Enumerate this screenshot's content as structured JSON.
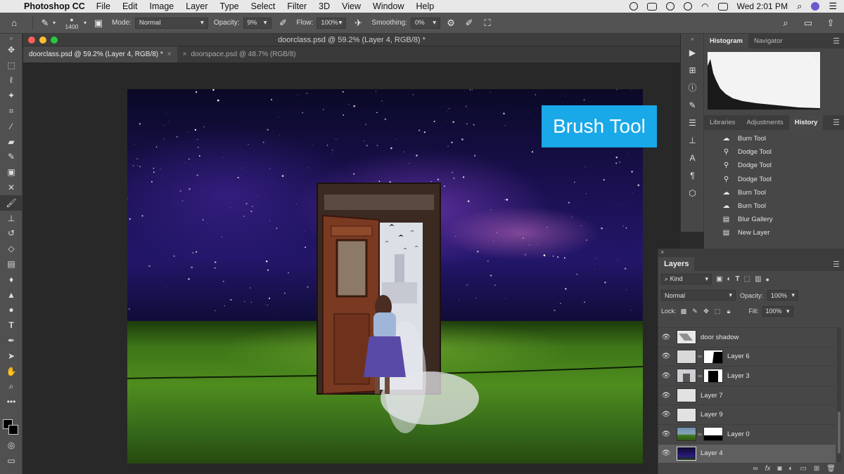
{
  "menubar": {
    "app_name": "Photoshop CC",
    "items": [
      "File",
      "Edit",
      "Image",
      "Layer",
      "Type",
      "Select",
      "Filter",
      "3D",
      "View",
      "Window",
      "Help"
    ],
    "clock": "Wed 2:01 PM"
  },
  "options_bar": {
    "brush_size": "1400",
    "mode_label": "Mode:",
    "mode_value": "Normal",
    "opacity_label": "Opacity:",
    "opacity_value": "9%",
    "flow_label": "Flow:",
    "flow_value": "100%",
    "smoothing_label": "Smoothing:",
    "smoothing_value": "0%"
  },
  "document": {
    "window_title": "doorclass.psd @ 59.2% (Layer 4, RGB/8) *",
    "tabs": [
      {
        "label": "doorclass.psd @ 59.2% (Layer 4, RGB/8) *",
        "active": true
      },
      {
        "label": "doorspace.psd @ 48.7% (RGB/8)",
        "active": false
      }
    ],
    "overlay_label": "Brush Tool"
  },
  "panels": {
    "top_tabs": [
      "Histogram",
      "Navigator"
    ],
    "mid_tabs": [
      "Libraries",
      "Adjustments",
      "History"
    ],
    "history": [
      {
        "label": "Burn Tool",
        "icon": "burn-icon"
      },
      {
        "label": "Dodge Tool",
        "icon": "dodge-icon"
      },
      {
        "label": "Dodge Tool",
        "icon": "dodge-icon"
      },
      {
        "label": "Dodge Tool",
        "icon": "dodge-icon"
      },
      {
        "label": "Burn Tool",
        "icon": "burn-icon"
      },
      {
        "label": "Burn Tool",
        "icon": "burn-icon"
      },
      {
        "label": "Blur Gallery",
        "icon": "document-icon"
      },
      {
        "label": "New Layer",
        "icon": "document-icon"
      }
    ]
  },
  "layers_panel": {
    "title": "Layers",
    "filter_kind": "Kind",
    "blend_mode": "Normal",
    "opacity_label": "Opacity:",
    "opacity_value": "100%",
    "lock_label": "Lock:",
    "fill_label": "Fill:",
    "fill_value": "100%",
    "layers": [
      {
        "name": "door shadow",
        "selected": false,
        "mask": false
      },
      {
        "name": "Layer 6",
        "selected": false,
        "mask": true
      },
      {
        "name": "Layer 3",
        "selected": false,
        "mask": true
      },
      {
        "name": "Layer 7",
        "selected": false,
        "mask": false
      },
      {
        "name": "Layer 9",
        "selected": false,
        "mask": false
      },
      {
        "name": "Layer 0",
        "selected": false,
        "mask": true
      },
      {
        "name": "Layer 4",
        "selected": true,
        "mask": false
      }
    ]
  },
  "colors": {
    "accent_label_bg": "#19a8e8",
    "ui_dark": "#535353"
  }
}
